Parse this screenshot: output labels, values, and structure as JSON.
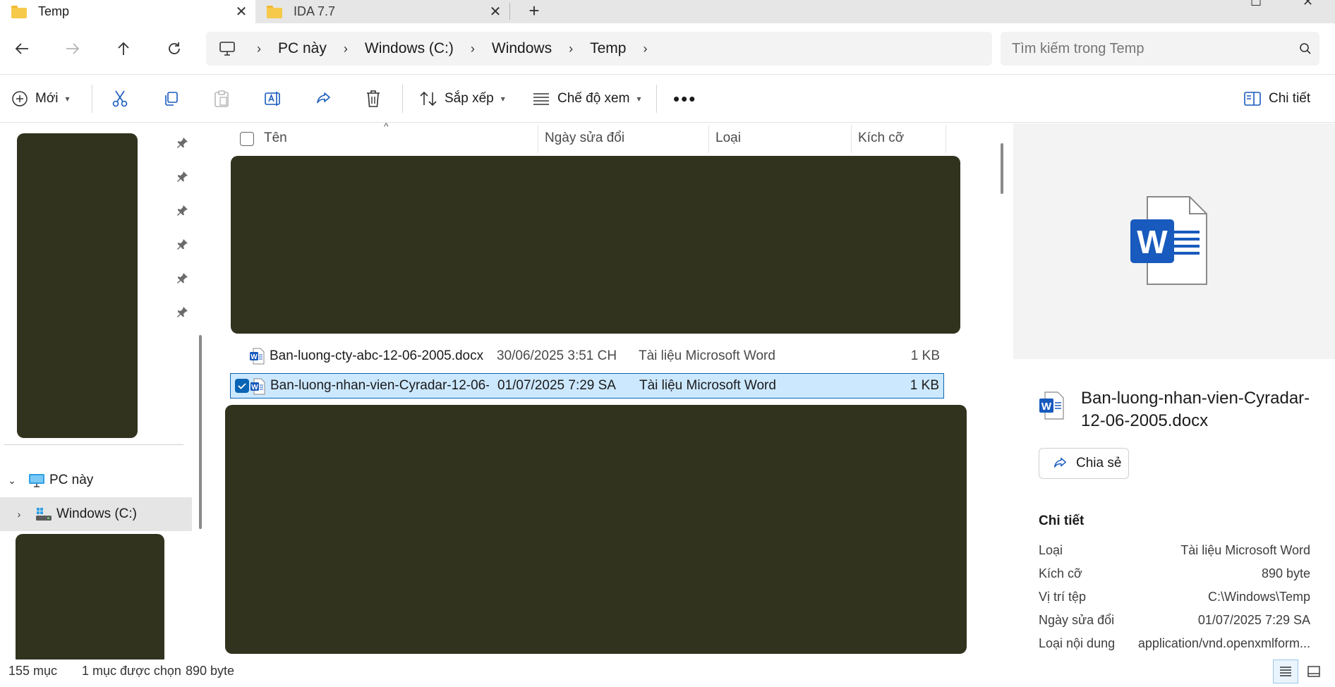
{
  "tabs": [
    {
      "title": "Temp",
      "active": true
    },
    {
      "title": "IDA 7.7",
      "active": false
    }
  ],
  "nav": {
    "breadcrumbs": [
      "PC này",
      "Windows (C:)",
      "Windows",
      "Temp"
    ],
    "search_placeholder": "Tìm kiếm trong Temp"
  },
  "commands": {
    "new_label": "Mới",
    "sort_label": "Sắp xếp",
    "view_label": "Chế độ xem",
    "details_label": "Chi tiết"
  },
  "sidebar": {
    "items": [
      {
        "label": "PC này",
        "expanded": true
      },
      {
        "label": "Windows (C:)",
        "expanded": false,
        "selected": true
      }
    ]
  },
  "columns": {
    "name": "Tên",
    "date": "Ngày sửa đổi",
    "type": "Loại",
    "size": "Kích cỡ"
  },
  "files": [
    {
      "name": "Ban-luong-cty-abc-12-06-2005.docx",
      "date": "30/06/2025 3:51 CH",
      "type": "Tài liệu Microsoft Word",
      "size": "1 KB",
      "selected": false
    },
    {
      "name": "Ban-luong-nhan-vien-Cyradar-12-06-2005.d...",
      "date": "01/07/2025 7:29 SA",
      "type": "Tài liệu Microsoft Word",
      "size": "1 KB",
      "selected": true
    }
  ],
  "details": {
    "file_name": "Ban-luong-nhan-vien-Cyradar-12-06-2005.docx",
    "share_label": "Chia sẻ",
    "section_title": "Chi tiết",
    "props": [
      {
        "key": "Loại",
        "value": "Tài liệu Microsoft Word"
      },
      {
        "key": "Kích cỡ",
        "value": "890 byte"
      },
      {
        "key": "Vị trí tệp",
        "value": "C:\\Windows\\Temp"
      },
      {
        "key": "Ngày sửa đổi",
        "value": "01/07/2025 7:29 SA"
      },
      {
        "key": "Loại nội dung",
        "value": "application/vnd.openxmlform..."
      }
    ]
  },
  "status": {
    "count": "155 mục",
    "selected": "1 mục được chọn",
    "size": "890 byte"
  },
  "colors": {
    "accent": "#0a64b4",
    "selection_bg": "#cce8ff",
    "redaction": "#32331e",
    "word_blue": "#185abd"
  }
}
